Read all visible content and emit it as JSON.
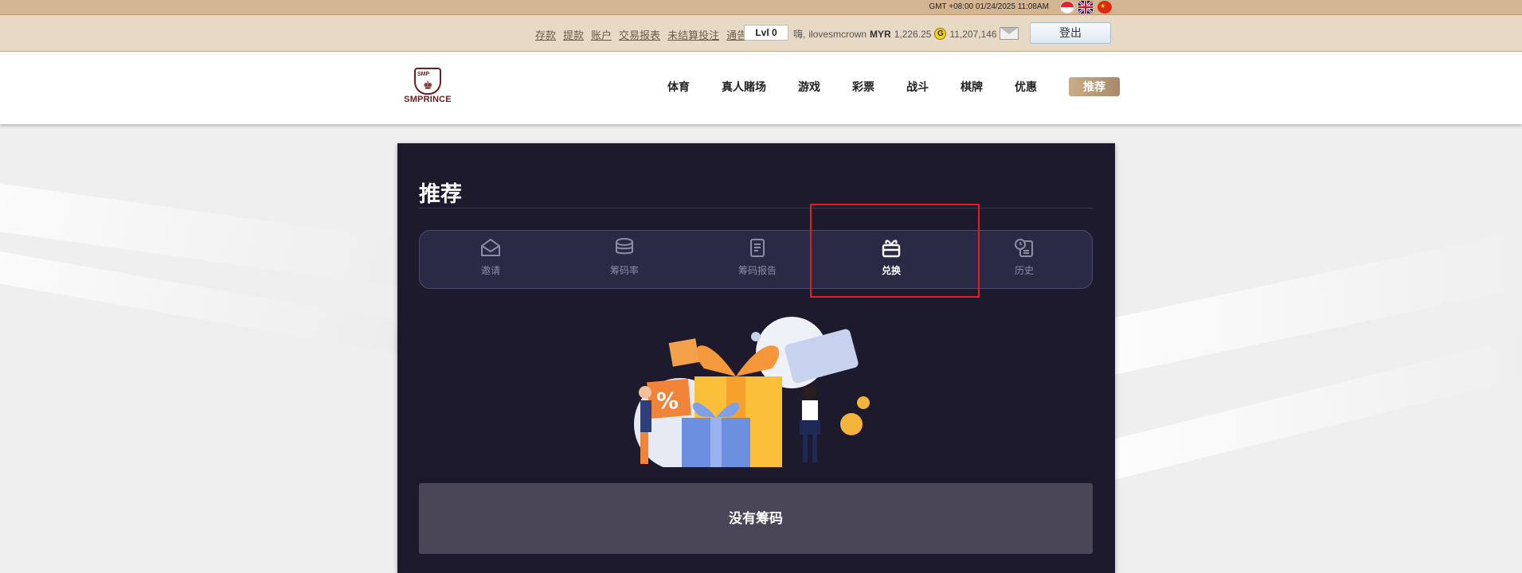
{
  "topbar": {
    "clock": "GMT +08:00 01/24/2025 11:08AM"
  },
  "account": {
    "links": [
      "存款",
      "提款",
      "账户",
      "交易报表",
      "未结算投注",
      "通告"
    ],
    "level": "Lvl 0",
    "greeting": "嗨,",
    "username": "ilovesmcrown",
    "currency": "MYR",
    "balance": "1,226.25",
    "coin_symbol": "G",
    "coins": "11,207,146",
    "logout_label": "登出"
  },
  "logo": {
    "brand": "SMPRINCE"
  },
  "nav": {
    "items": [
      "体育",
      "真人賭场",
      "游戏",
      "彩票",
      "战斗",
      "棋牌",
      "优惠",
      "推荐"
    ],
    "active": "推荐"
  },
  "panel": {
    "title": "推荐",
    "tabs": [
      {
        "label": "邀请",
        "icon": "envelope-icon"
      },
      {
        "label": "筹码率",
        "icon": "coins-icon"
      },
      {
        "label": "筹码报告",
        "icon": "clipboard-icon"
      },
      {
        "label": "兑换",
        "icon": "gift-icon"
      },
      {
        "label": "历史",
        "icon": "history-icon"
      }
    ],
    "active_tab": "兑换",
    "empty_message": "没有筹码"
  },
  "colors": {
    "panel_bg": "#1c1a2c",
    "tab_bg": "#2b2a46",
    "highlight": "#e02121",
    "nav_active": "#b8997a",
    "topstrip": "#d3b592",
    "account_bar": "#e8d9c4"
  }
}
